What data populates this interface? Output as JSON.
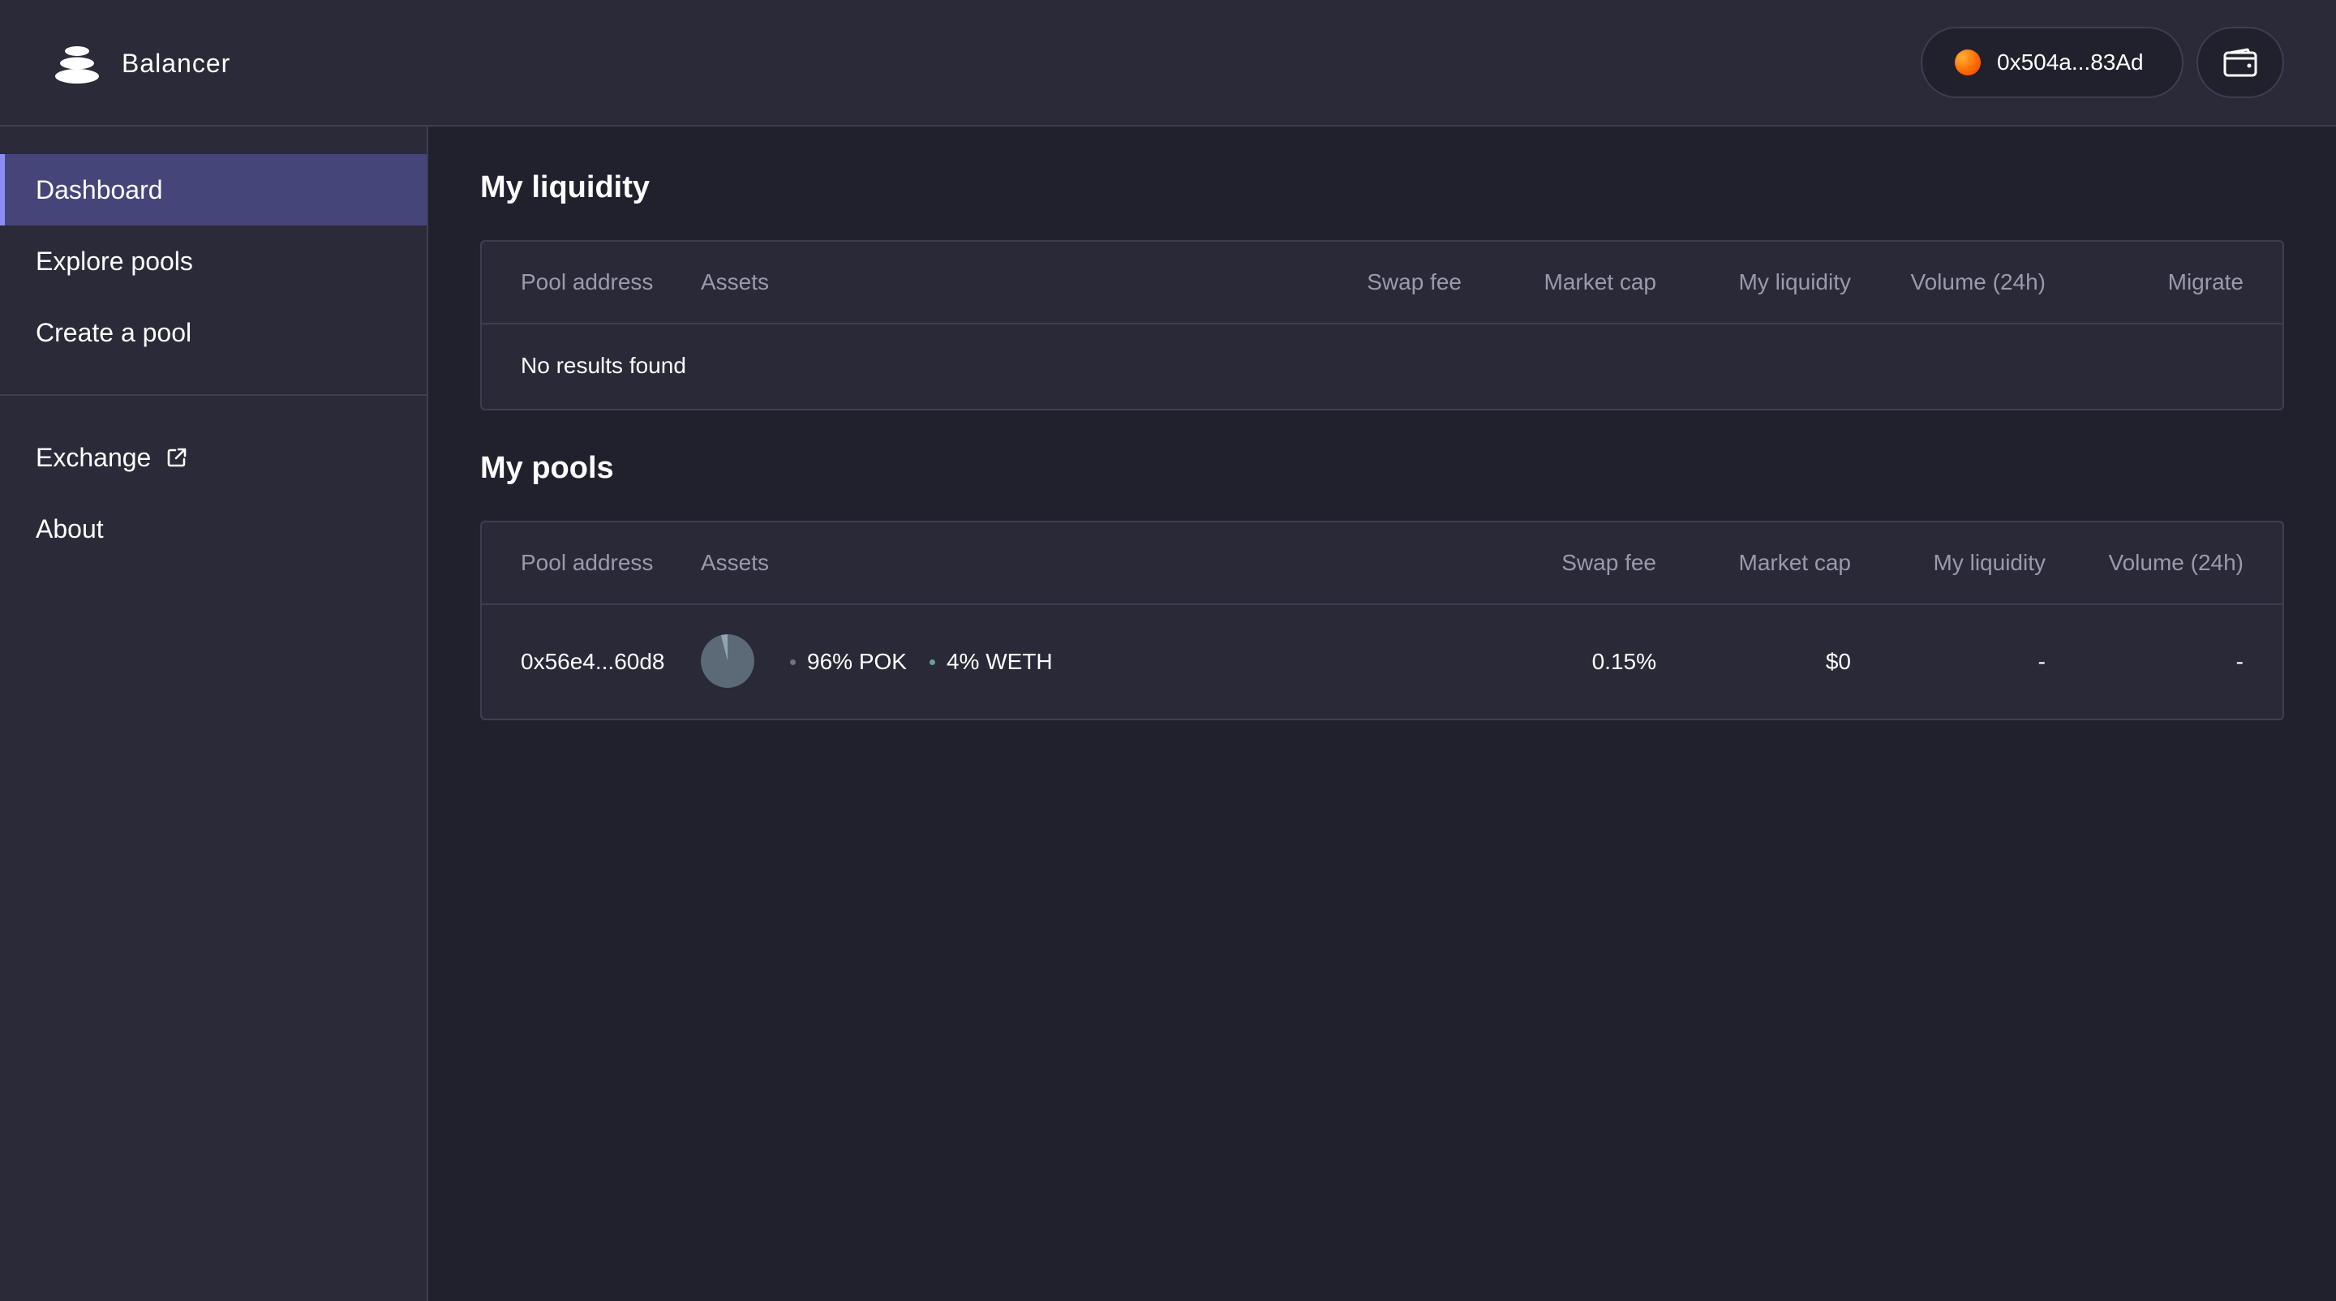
{
  "app": {
    "brand_name": "Balancer"
  },
  "header": {
    "account_address": "0x504a...83Ad",
    "avatar_colors": [
      "#ffb13b",
      "#ff6a00"
    ]
  },
  "sidebar": {
    "items": [
      {
        "label": "Dashboard",
        "active": true
      },
      {
        "label": "Explore pools",
        "active": false
      },
      {
        "label": "Create a pool",
        "active": false
      }
    ],
    "secondary_items": [
      {
        "label": "Exchange",
        "icon": "external-link-icon"
      },
      {
        "label": "About"
      }
    ]
  },
  "my_liquidity": {
    "title": "My liquidity",
    "columns": [
      "Pool address",
      "Assets",
      "Swap fee",
      "Market cap",
      "My liquidity",
      "Volume (24h)",
      "Migrate"
    ],
    "empty_text": "No results found"
  },
  "my_pools": {
    "title": "My pools",
    "columns": [
      "Pool address",
      "Assets",
      "Swap fee",
      "Market cap",
      "My liquidity",
      "Volume (24h)"
    ],
    "rows": [
      {
        "pool_address": "0x56e4...60d8",
        "assets": [
          {
            "label": "96% POK",
            "weight": 0.96,
            "color": "#5c6977",
            "dot_color": "#71717f"
          },
          {
            "label": "4% WETH",
            "weight": 0.04,
            "color": "#8fa6b0",
            "dot_color": "#6f9c98"
          }
        ],
        "swap_fee": "0.15%",
        "market_cap": "$0",
        "my_liquidity": "-",
        "volume_24h": "-"
      }
    ]
  },
  "colors": {
    "background": "#21212e",
    "panel": "#292937",
    "border": "#3e3e52",
    "active_nav": "#45457a",
    "active_accent": "#8c8cf2",
    "muted_text": "#9a9aac"
  }
}
